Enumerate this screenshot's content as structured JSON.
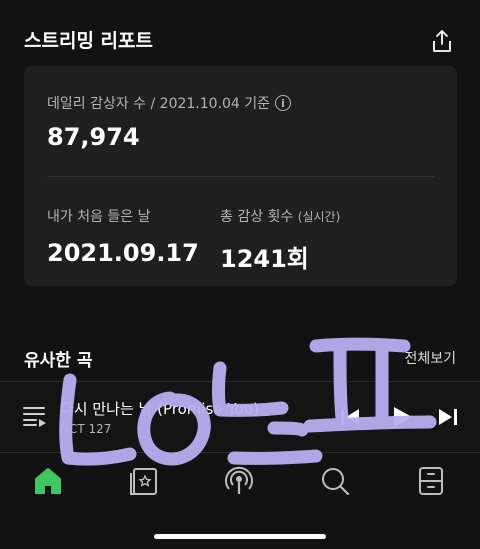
{
  "header": {
    "title": "스트리밍 리포트"
  },
  "card": {
    "daily_label": "데일리 감상자 수 / 2021.10.04 기준",
    "daily_value": "87,974",
    "first_listen_label": "내가 처음 들은 날",
    "first_listen_value": "2021.09.17",
    "total_plays_label": "총 감상 횟수",
    "total_plays_sub": "(실시간)",
    "total_plays_value": "1241회"
  },
  "similar": {
    "title": "유사한 곡",
    "see_all": "전체보기"
  },
  "player": {
    "track_title": "다시 만나는 날 (Promise You)",
    "artist": "NCT 127"
  },
  "nav": {
    "items": [
      {
        "icon": "home-icon",
        "active": true
      },
      {
        "icon": "playlist-icon",
        "active": false
      },
      {
        "icon": "podcast-icon",
        "active": false
      },
      {
        "icon": "search-icon",
        "active": false
      },
      {
        "icon": "library-icon",
        "active": false
      }
    ]
  },
  "colors": {
    "background": "#121212",
    "card": "#1f1f1f",
    "accent": "#3ec65f",
    "scribble": "#b9aef2"
  }
}
